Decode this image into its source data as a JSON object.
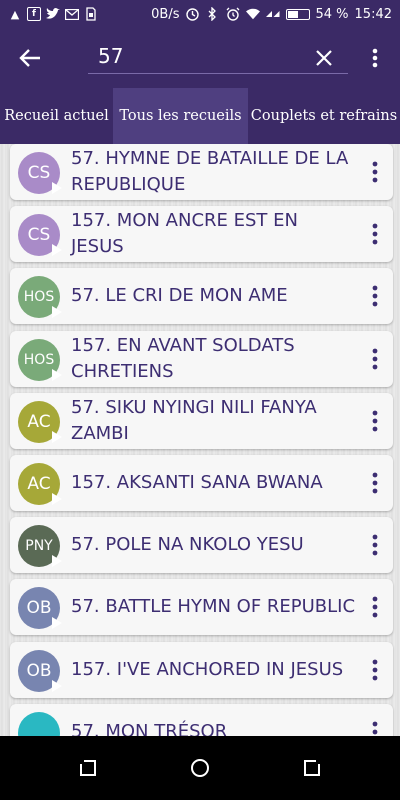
{
  "status_bar": {
    "speed": "0B/s",
    "battery_percent": "54 %",
    "battery_level": 0.54,
    "time": "15:42",
    "icons": [
      "notification-icon",
      "facebook-icon",
      "twitter-icon",
      "mail-icon",
      "sim-icon",
      "data-saver-icon",
      "bluetooth-icon",
      "alarm-icon",
      "wifi-icon",
      "signal-icon",
      "battery-icon"
    ]
  },
  "app_bar": {
    "search_value": "57"
  },
  "tabs": [
    {
      "label": "Recueil actuel",
      "selected": false
    },
    {
      "label": "Tous les recueils",
      "selected": true
    },
    {
      "label": "Couplets et refrains",
      "selected": false
    }
  ],
  "items": [
    {
      "badge": "CS",
      "color": "#a98bc8",
      "title": "57. HYMNE DE BATAILLE DE LA REPUBLIQUE"
    },
    {
      "badge": "CS",
      "color": "#a98bc8",
      "title": "157. MON ANCRE EST EN JESUS"
    },
    {
      "badge": "HOS",
      "color": "#7aaa79",
      "title": "57. LE CRI DE MON AME"
    },
    {
      "badge": "HOS",
      "color": "#7aaa79",
      "title": "157. EN AVANT SOLDATS CHRETIENS"
    },
    {
      "badge": "AC",
      "color": "#a6a838",
      "title": "57. SIKU NYINGI NILI FANYA ZAMBI"
    },
    {
      "badge": "AC",
      "color": "#a6a838",
      "title": "157. AKSANTI SANA BWANA"
    },
    {
      "badge": "PNY",
      "color": "#5a6a55",
      "title": "57. POLE NA NKOLO YESU"
    },
    {
      "badge": "OB",
      "color": "#7885b0",
      "title": "57. BATTLE HYMN OF REPUBLIC"
    },
    {
      "badge": "OB",
      "color": "#7885b0",
      "title": "157. I'VE ANCHORED IN JESUS"
    },
    {
      "badge": "",
      "color": "#2ab8c2",
      "title": "57. MON TRÉSOR"
    }
  ]
}
